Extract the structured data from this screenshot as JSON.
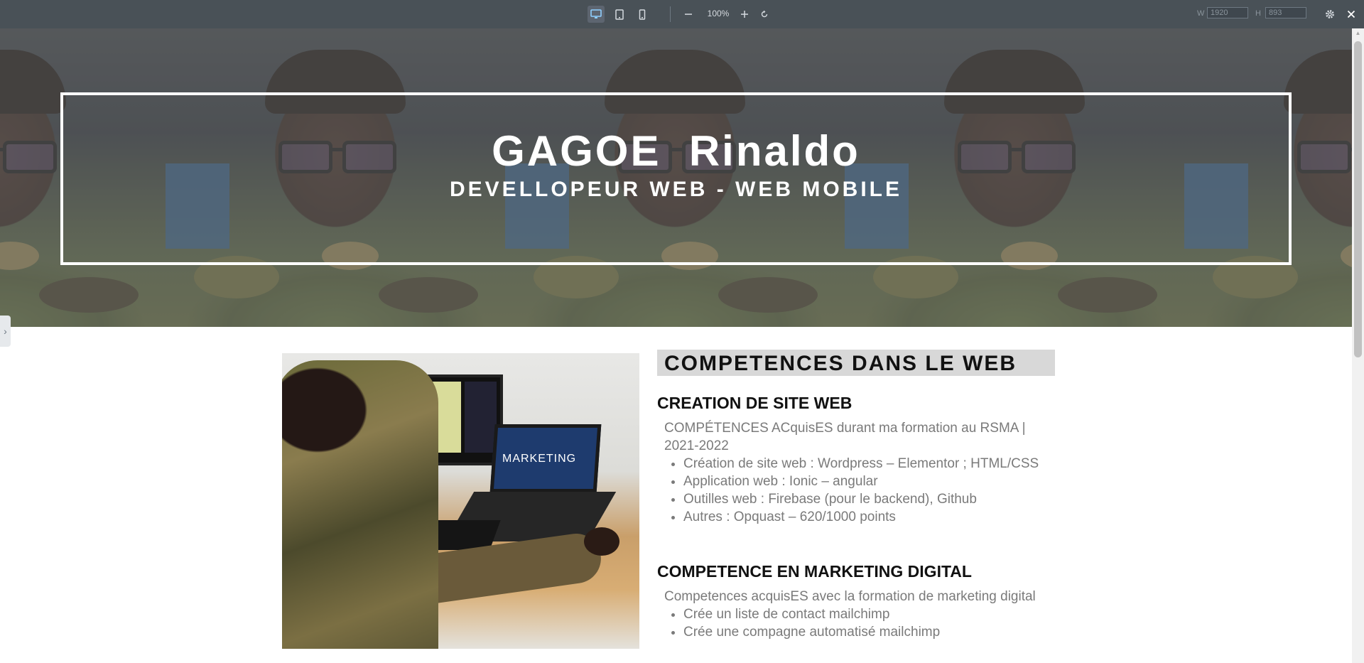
{
  "toolbar": {
    "zoom_level": "100%",
    "width_label": "W",
    "width_value": "1920",
    "height_label": "H",
    "height_value": "893",
    "icons": [
      "desktop-icon",
      "tablet-icon",
      "mobile-icon",
      "zoom-out-icon",
      "zoom-in-icon",
      "reset-icon",
      "gear-icon",
      "close-icon"
    ],
    "active_device": "desktop"
  },
  "hero": {
    "name": "GAGOE  Rinaldo",
    "subtitle": "DEVELLOPEUR WEB - WEB MOBILE"
  },
  "main": {
    "section_title": "COMPETENCES DANS LE WEB",
    "web": {
      "heading": "CREATION DE SITE WEB",
      "intro": "COMPÉTENCES ACquisES durant ma formation au RSMA | 2021-2022",
      "items": [
        "Création de site web : Wordpress – Elementor ; HTML/CSS",
        "Application web : Ionic – angular",
        "Outilles web : Firebase (pour le backend), Github",
        "Autres : Opquast – 620/1000 points"
      ]
    },
    "marketing": {
      "heading": "COMPETENCE EN MARKETING DIGITAL",
      "intro": "Competences acquisES avec la formation de marketing digital",
      "items": [
        "Crée un liste de contact mailchimp",
        "Crée une compagne automatisé mailchimp"
      ]
    },
    "photo_caption": "MARKETING"
  },
  "colors": {
    "toolbar_bg": "#495157",
    "section_title_bg": "#d8d8d8",
    "body_text": "#7a7a7a",
    "heading_text": "#111111"
  }
}
